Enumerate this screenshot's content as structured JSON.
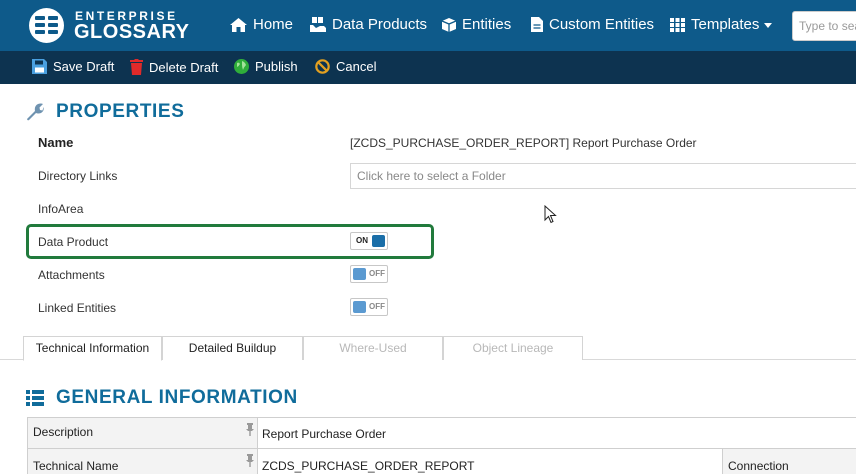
{
  "brand": {
    "line1": "ENTERPRISE",
    "line2": "GLOSSARY"
  },
  "nav": {
    "home": "Home",
    "data_products": "Data Products",
    "entities": "Entities",
    "custom_entities": "Custom Entities",
    "templates": "Templates"
  },
  "search": {
    "placeholder": "Type to search"
  },
  "actions": {
    "save_draft": "Save Draft",
    "delete_draft": "Delete Draft",
    "publish": "Publish",
    "cancel": "Cancel"
  },
  "properties": {
    "heading": "PROPERTIES",
    "name_label": "Name",
    "name_value": "[ZCDS_PURCHASE_ORDER_REPORT] Report Purchase Order",
    "directory_label": "Directory Links",
    "directory_placeholder": "Click here to select a Folder",
    "infoarea_label": "InfoArea",
    "data_product_label": "Data Product",
    "data_product_toggle": "ON",
    "attachments_label": "Attachments",
    "attachments_toggle": "OFF",
    "linked_label": "Linked Entities",
    "linked_toggle": "OFF"
  },
  "tabs": {
    "technical": "Technical Information",
    "detailed": "Detailed Buildup",
    "where_used": "Where-Used",
    "lineage": "Object Lineage"
  },
  "general": {
    "heading": "GENERAL INFORMATION",
    "description_label": "Description",
    "description_value": "Report Purchase Order",
    "technical_name_label": "Technical Name",
    "technical_name_value": "ZCDS_PURCHASE_ORDER_REPORT",
    "connection_label": "Connection"
  },
  "colors": {
    "nav_bg": "#0e5a8a",
    "action_bg": "#0d3350",
    "heading": "#106c9b",
    "highlight": "#217a3c"
  }
}
